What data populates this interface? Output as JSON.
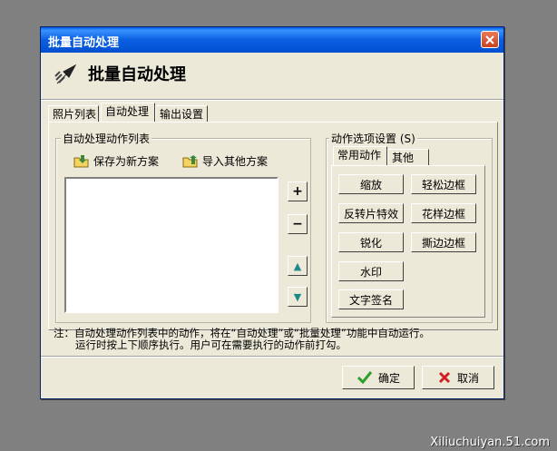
{
  "window": {
    "title": "批量自动处理"
  },
  "header": {
    "title": "批量自动处理",
    "icon": "batch-arrow-icon"
  },
  "tabs": [
    {
      "label": "照片列表"
    },
    {
      "label": "自动处理"
    },
    {
      "label": "输出设置"
    }
  ],
  "active_tab": "自动处理",
  "action_list": {
    "group_label": "自动处理动作列表",
    "save_label": "保存为新方案",
    "import_label": "导入其他方案",
    "items": [],
    "add_glyph": "+",
    "remove_glyph": "−",
    "up_glyph": "▲",
    "down_glyph": "▼"
  },
  "action_options": {
    "group_label": "动作选项设置 (S)",
    "tabs": [
      {
        "label": "常用动作"
      },
      {
        "label": "其他"
      }
    ],
    "active_tab": "常用动作",
    "buttons": {
      "zoom": "缩放",
      "easy_border": "轻松边框",
      "invert_effect": "反转片特效",
      "fancy_border": "花样边框",
      "sharpen": "锐化",
      "torn_border": "撕边边框",
      "watermark": "水印",
      "text_signature": "文字签名"
    }
  },
  "note": {
    "line1": "注：自动处理动作列表中的动作，将在“自动处理”或“批量处理”功能中自动运行。",
    "line2": "运行时按上下顺序执行。用户可在需要执行的动作前打勾。"
  },
  "footer": {
    "ok_label": "确定",
    "cancel_label": "取消"
  },
  "site_watermark": "Xiliuchuiyan.51.com",
  "colors": {
    "titlebar": "#0A5FE0",
    "dialog_bg": "#ECE9D8",
    "close_red": "#D8532E",
    "ok_green": "#2E9E2E",
    "cancel_red": "#D02020",
    "arrow_teal": "#1A8A8A"
  }
}
